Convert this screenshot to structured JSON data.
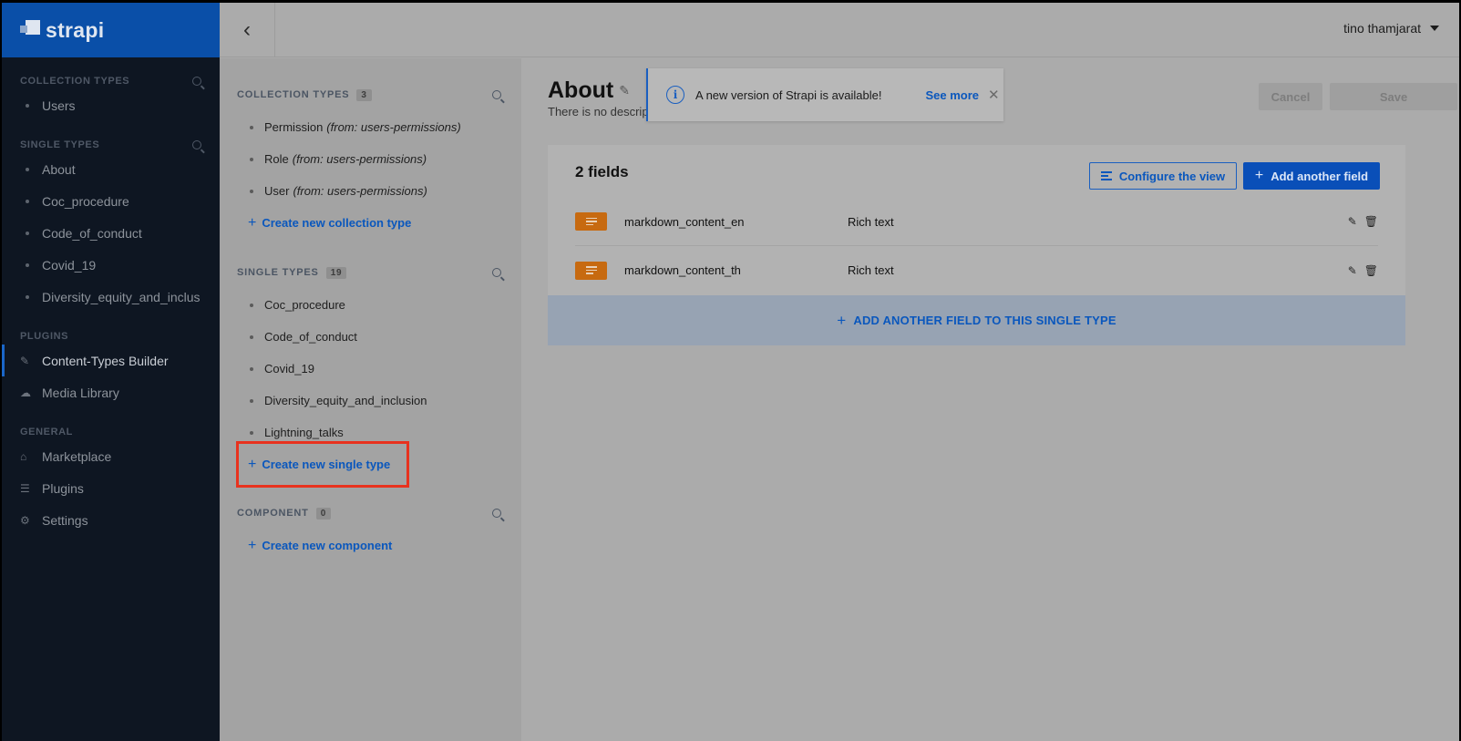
{
  "app": {
    "brand": "strapi"
  },
  "topbar": {
    "back_icon": "chevron-left-icon",
    "user_name": "tino thamjarat"
  },
  "nav": {
    "sections": [
      {
        "title": "COLLECTION TYPES",
        "items": [
          "Users"
        ]
      },
      {
        "title": "SINGLE TYPES",
        "items": [
          "About",
          "Coc_procedure",
          "Code_of_conduct",
          "Covid_19",
          "Diversity_equity_and_inclus"
        ]
      },
      {
        "title": "PLUGINS",
        "items": [
          "Content-Types Builder",
          "Media Library"
        ]
      },
      {
        "title": "GENERAL",
        "items": [
          "Marketplace",
          "Plugins",
          "Settings"
        ]
      }
    ]
  },
  "builder": {
    "collection": {
      "title": "COLLECTION TYPES",
      "count": "3",
      "items": [
        {
          "name": "Permission",
          "source": "(from: users-permissions)"
        },
        {
          "name": "Role",
          "source": "(from: users-permissions)"
        },
        {
          "name": "User",
          "source": "(from: users-permissions)"
        }
      ],
      "create_label": "Create new collection type"
    },
    "single": {
      "title": "SINGLE TYPES",
      "count": "19",
      "items": [
        "Coc_procedure",
        "Code_of_conduct",
        "Covid_19",
        "Diversity_equity_and_inclusion",
        "Lightning_talks"
      ],
      "create_label": "Create new single type"
    },
    "component": {
      "title": "COMPONENT",
      "count": "0",
      "create_label": "Create new component"
    }
  },
  "main": {
    "title": "About",
    "description": "There is no description",
    "notification": {
      "text": "A new version of Strapi is available!",
      "link": "See more"
    },
    "cancel_label": "Cancel",
    "save_label": "Save",
    "fields_count_label": "2 fields",
    "configure_label": "Configure the view",
    "add_field_label": "Add another field",
    "fields": [
      {
        "name": "markdown_content_en",
        "type": "Rich text"
      },
      {
        "name": "markdown_content_th",
        "type": "Rich text"
      }
    ],
    "add_field_bar_label": "ADD ANOTHER FIELD TO THIS SINGLE TYPE"
  },
  "colors": {
    "accent": "#0a57bd",
    "brand_bar": "#0a4fa8",
    "nav_bg": "#0e1622",
    "highlight": "#e8321e",
    "field_icon": "#c76a10"
  }
}
